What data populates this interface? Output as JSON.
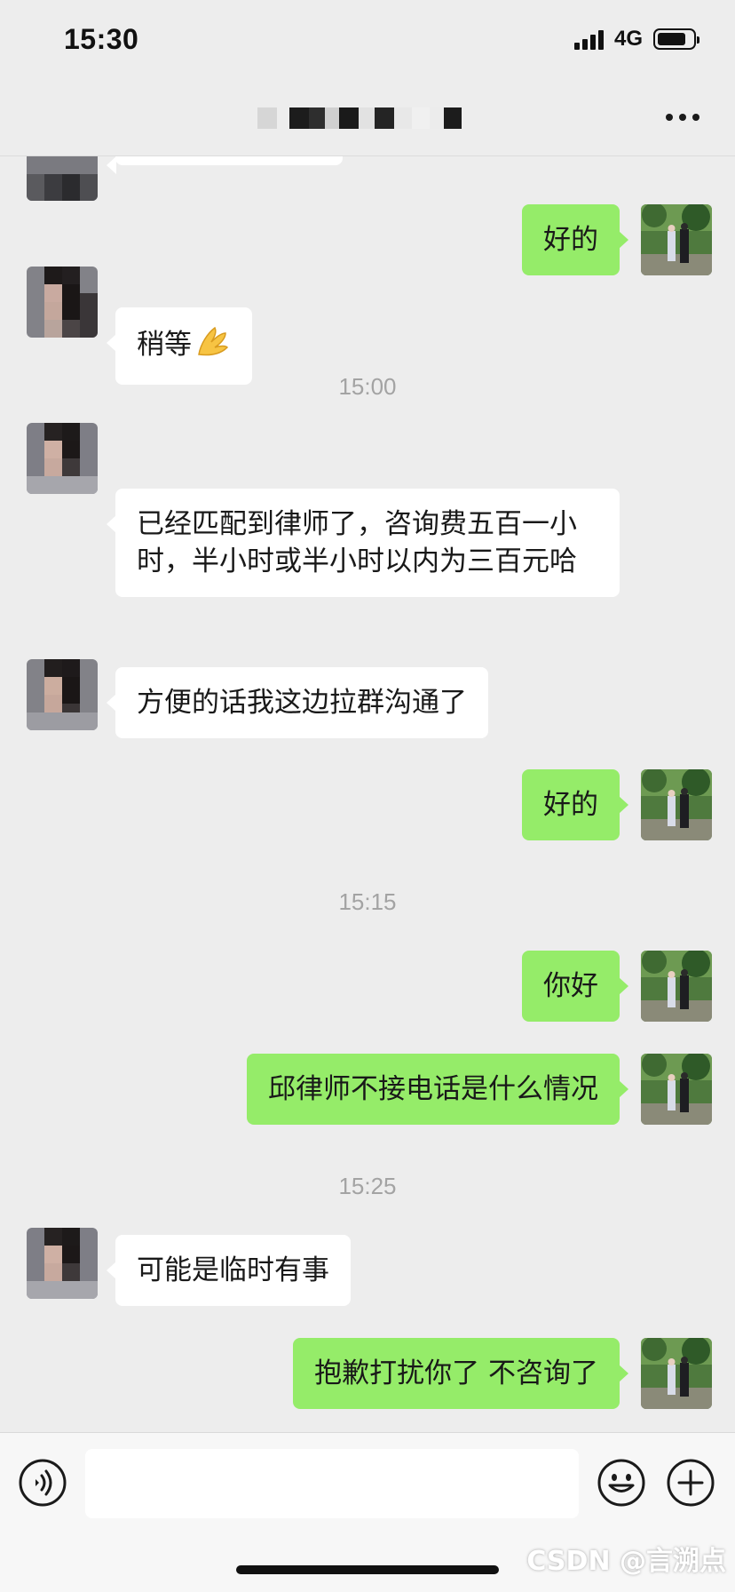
{
  "status_bar": {
    "time": "15:30",
    "network": "4G"
  },
  "nav": {
    "more_icon": "more-dots-icon"
  },
  "messages": [
    {
      "type": "in",
      "text": "稍等",
      "emoji": "pinched-fingers-icon"
    },
    {
      "type": "time",
      "text": "15:00"
    },
    {
      "type": "in",
      "text": "已经匹配到律师了，咨询费五百一小时，半小时或半小时以内为三百元哈"
    },
    {
      "type": "in",
      "text": "方便的话我这边拉群沟通了"
    },
    {
      "type": "out",
      "text": "好的"
    },
    {
      "type": "time",
      "text": "15:15"
    },
    {
      "type": "out",
      "text": "你好"
    },
    {
      "type": "out",
      "text": "邱律师不接电话是什么情况"
    },
    {
      "type": "time",
      "text": "15:25"
    },
    {
      "type": "in",
      "text": "可能是临时有事"
    },
    {
      "type": "out",
      "text": "抱歉打扰你了 不咨询了"
    }
  ],
  "first_reply": {
    "text": "好的"
  },
  "input_bar": {
    "voice_icon": "voice-icon",
    "emoji_icon": "smiley-icon",
    "plus_icon": "plus-icon",
    "value": ""
  },
  "watermark": "CSDN @言溯点",
  "colors": {
    "background": "#ededed",
    "outgoing_bubble": "#95ec69",
    "incoming_bubble": "#ffffff",
    "timestamp": "#a3a3a3"
  }
}
